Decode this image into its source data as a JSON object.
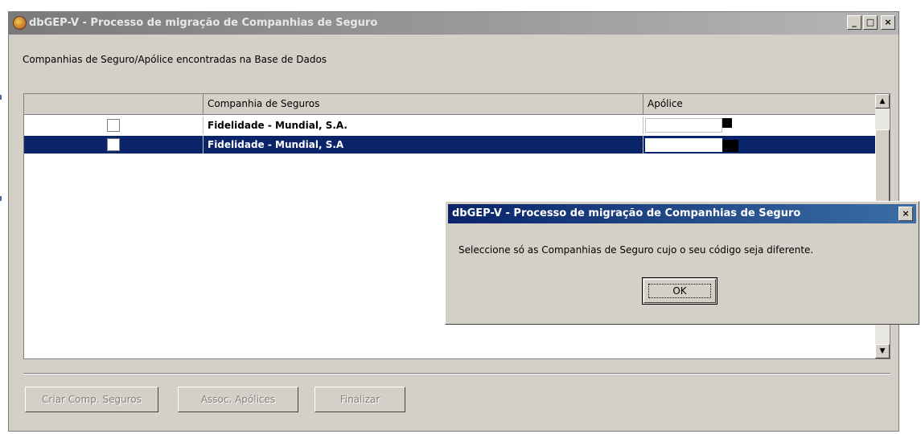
{
  "window": {
    "title": "dbGEP-V - Processo de migração de Companhias de Seguro",
    "controls": {
      "minimize": "_",
      "maximize": "□",
      "close": "×"
    }
  },
  "main": {
    "section_label": "Companhias de Seguro/Apólice encontradas na Base de Dados",
    "grid": {
      "columns": [
        "",
        "Companhia de Seguros",
        "Apólice"
      ],
      "rows": [
        {
          "checked": false,
          "company": "Fidelidade - Mundial, S.A.",
          "policy": "",
          "selected": false
        },
        {
          "checked": false,
          "company": "Fidelidade - Mundial, S.A",
          "policy": "",
          "selected": true
        }
      ]
    }
  },
  "buttons": {
    "create": "Criar Comp. Seguros",
    "associate": "Assoc. Apólices",
    "finish": "Finalizar"
  },
  "dialog": {
    "title": "dbGEP-V - Processo de migração de Companhias de Seguro",
    "message": "Seleccione só as Companhias de Seguro cujo o seu código seja diferente.",
    "ok_label": "OK"
  },
  "colors": {
    "active_title": "#0a246a",
    "inactive_title": "#7a7a7a",
    "face": "#d4d0c8",
    "selection": "#0a246a"
  }
}
